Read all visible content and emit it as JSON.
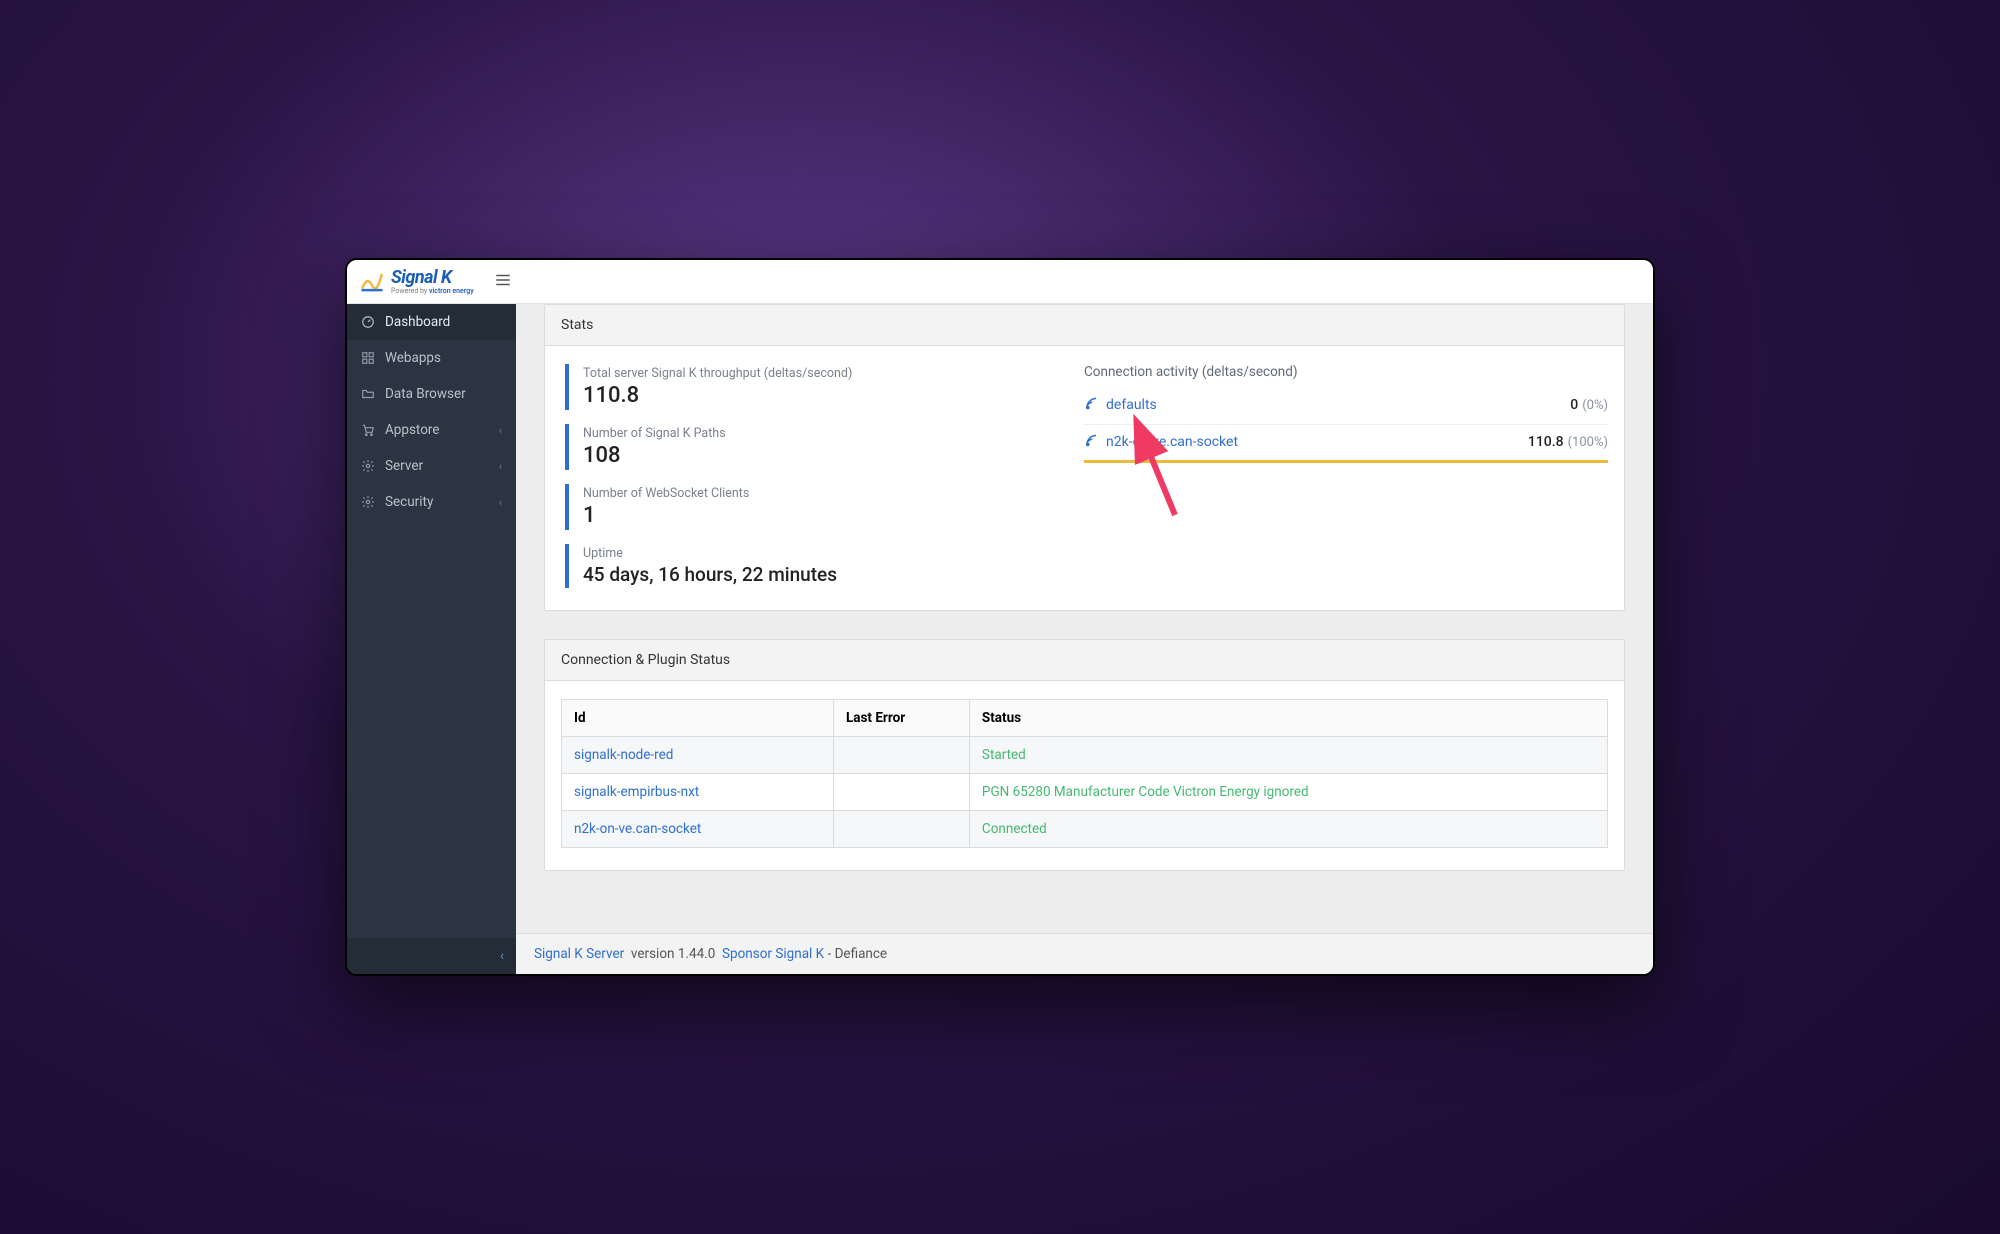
{
  "brand": {
    "name": "Signal K",
    "sub_prefix": "Powered by ",
    "sub_vendor": "victron energy"
  },
  "sidebar": {
    "items": [
      {
        "label": "Dashboard",
        "icon": "gauge-icon",
        "active": true,
        "expandable": false
      },
      {
        "label": "Webapps",
        "icon": "grid-icon",
        "active": false,
        "expandable": false
      },
      {
        "label": "Data Browser",
        "icon": "folder-icon",
        "active": false,
        "expandable": false
      },
      {
        "label": "Appstore",
        "icon": "cart-icon",
        "active": false,
        "expandable": true
      },
      {
        "label": "Server",
        "icon": "gear-icon",
        "active": false,
        "expandable": true
      },
      {
        "label": "Security",
        "icon": "gear-icon",
        "active": false,
        "expandable": true
      }
    ]
  },
  "cards": {
    "stats": "Stats",
    "conn": "Connection & Plugin Status"
  },
  "stats": [
    {
      "label": "Total server Signal K throughput (deltas/second)",
      "value": "110.8"
    },
    {
      "label": "Number of Signal K Paths",
      "value": "108"
    },
    {
      "label": "Number of WebSocket Clients",
      "value": "1"
    },
    {
      "label": "Uptime",
      "value": "45 days, 16 hours, 22 minutes"
    }
  ],
  "activity": {
    "title": "Connection activity (deltas/second)",
    "rows": [
      {
        "name": "defaults",
        "value": "0",
        "pct": "(0%)",
        "bar_pct": 0
      },
      {
        "name": "n2k-on-ve.can-socket",
        "value": "110.8",
        "pct": "(100%)",
        "bar_pct": 100
      }
    ]
  },
  "status_table": {
    "headers": [
      "Id",
      "Last Error",
      "Status"
    ],
    "rows": [
      {
        "id": "signalk-node-red",
        "last_error": "",
        "status": "Started"
      },
      {
        "id": "signalk-empirbus-nxt",
        "last_error": "",
        "status": "PGN 65280 Manufacturer Code Victron Energy ignored"
      },
      {
        "id": "n2k-on-ve.can-socket",
        "last_error": "",
        "status": "Connected"
      }
    ]
  },
  "footer": {
    "app_link": "Signal K Server",
    "version": "version 1.44.0",
    "sponsor": "Sponsor Signal K",
    "suffix": " - Defiance"
  },
  "colors": {
    "accent": "#2e6fd1",
    "bar": "#f0b93a",
    "ok": "#46b971",
    "sidebar_bg": "#2b3441"
  }
}
